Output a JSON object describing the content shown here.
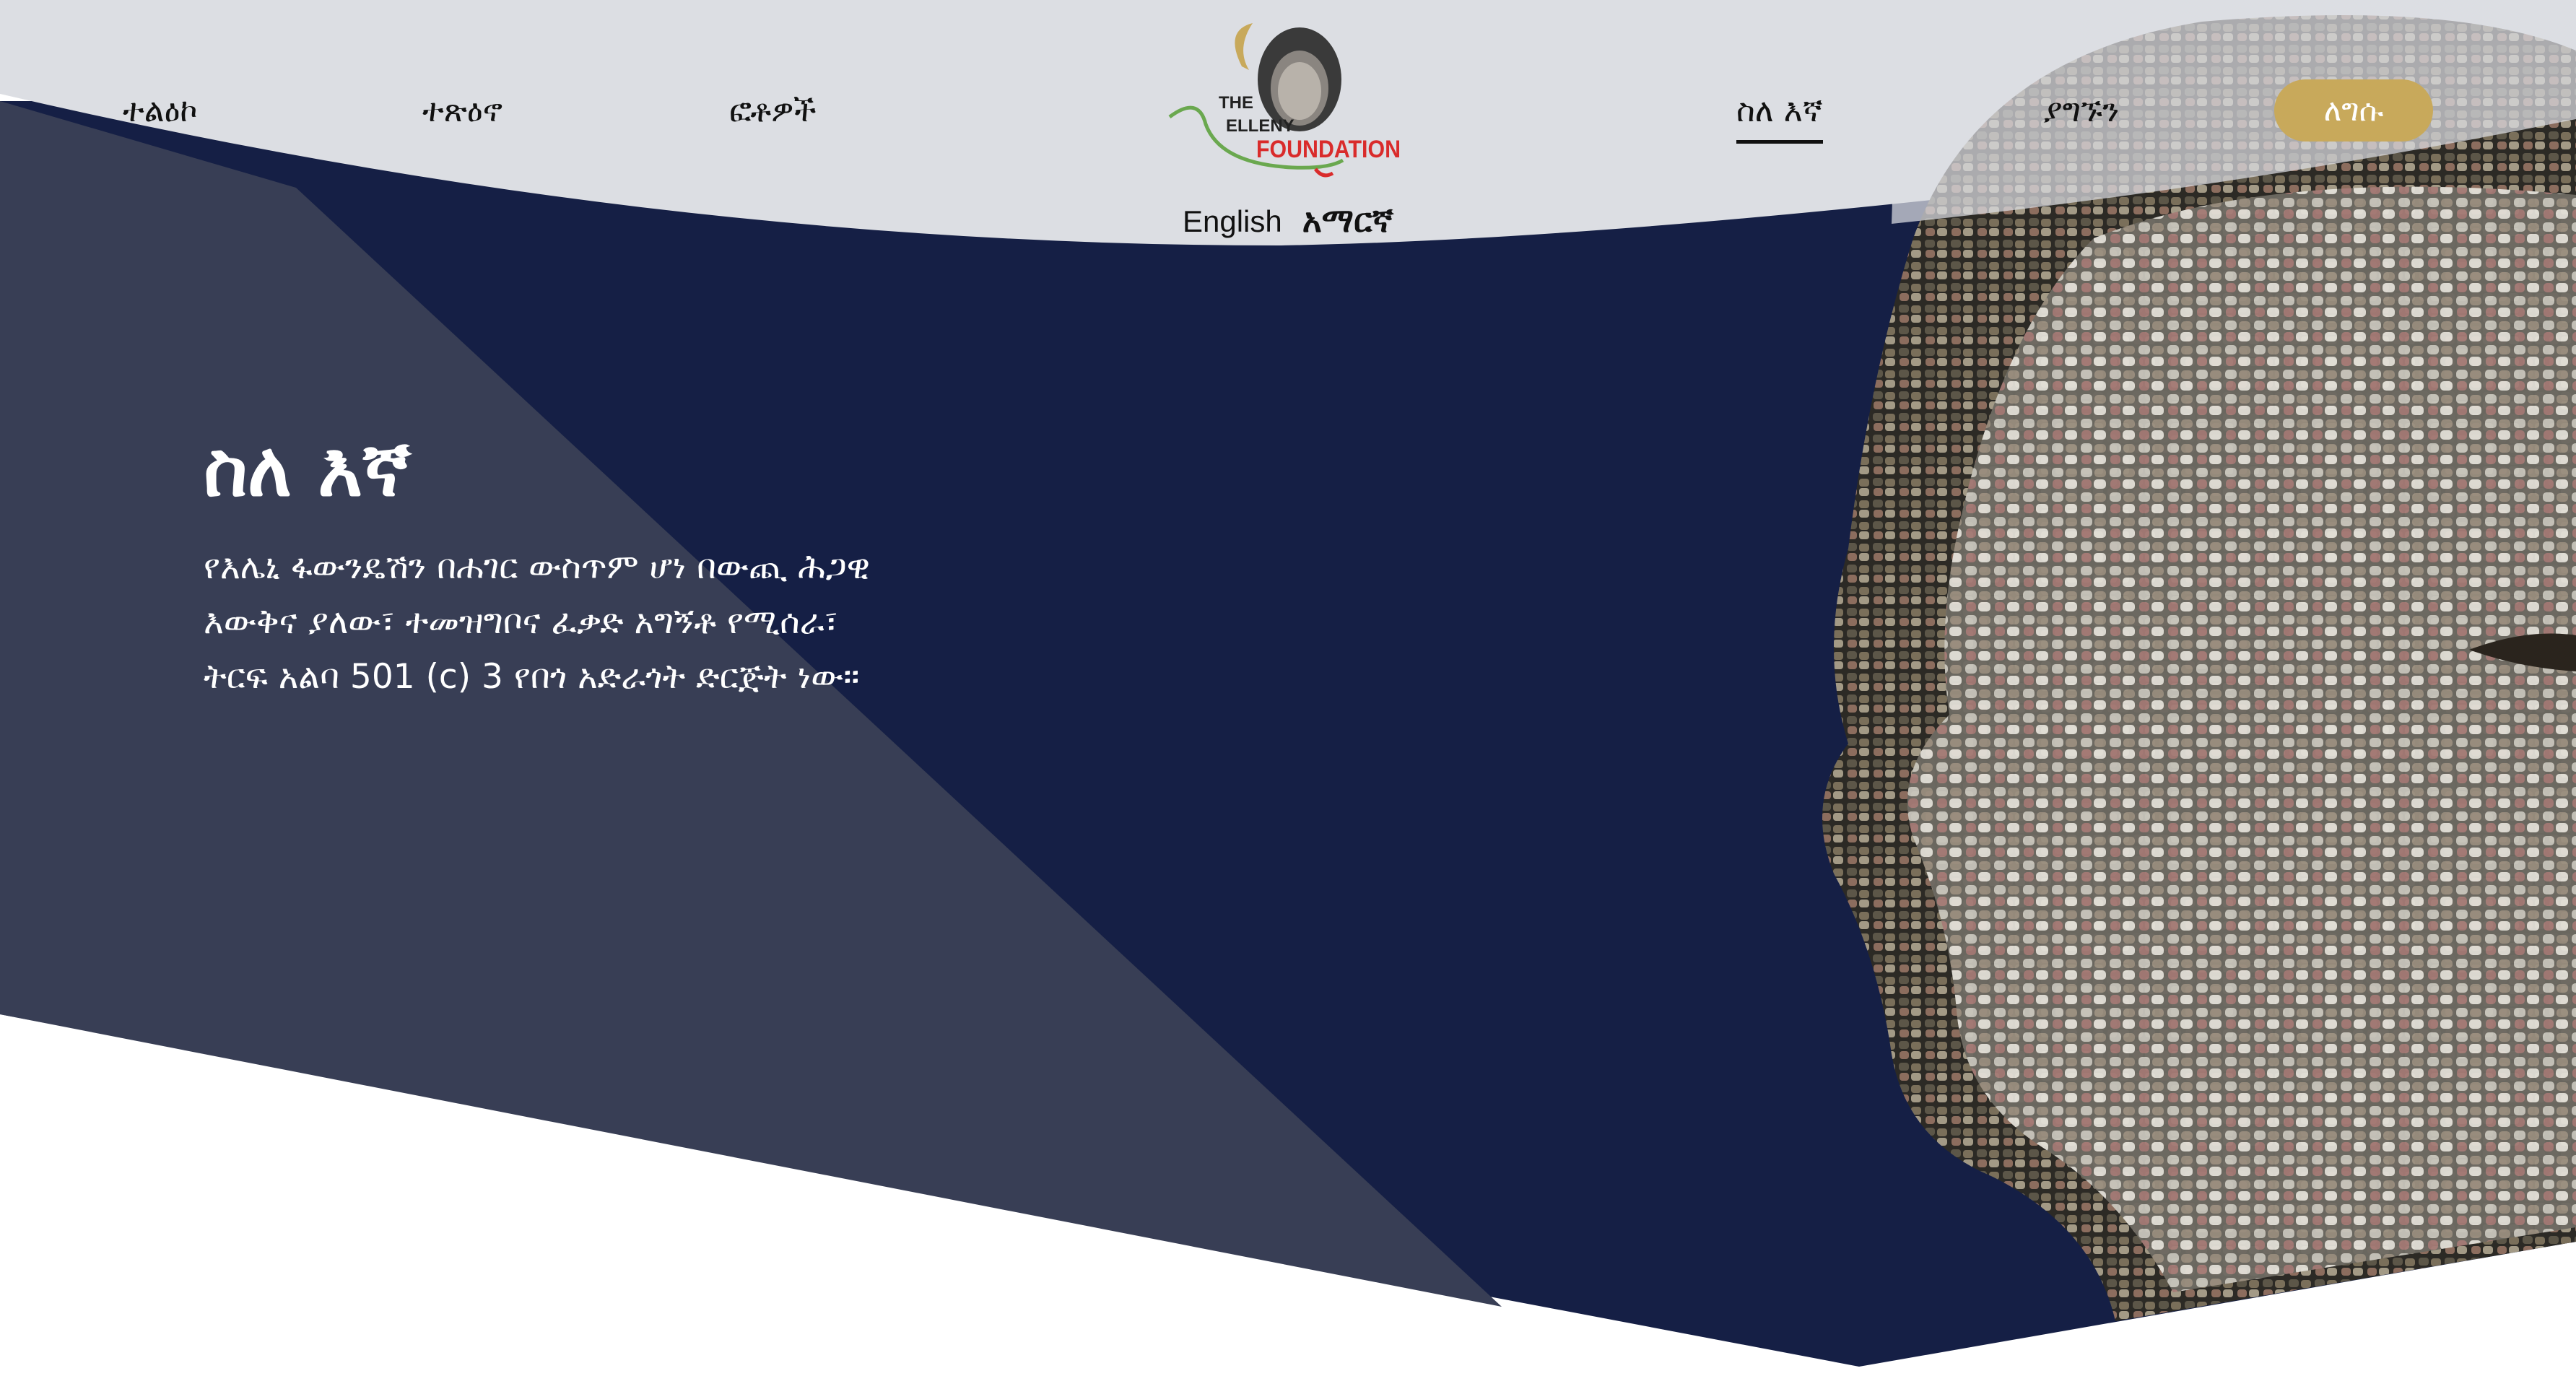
{
  "nav": {
    "left_items": [
      "ተልዕኮ",
      "ተጽዕኖ",
      "ፎቶዎች"
    ],
    "right_items": [
      "ስለ እኛ",
      "ያግኙን"
    ],
    "active_item": "ስለ እኛ",
    "donate_label": "ለግሱ"
  },
  "logo": {
    "line1": "THE",
    "line2": "ELLENY",
    "line3": "FOUNDATION"
  },
  "language": {
    "english": "English",
    "amharic": "አማርኛ",
    "selected": "አማርኛ"
  },
  "hero": {
    "title": "ስለ እኛ",
    "description": "የእሌኒ ፋውንዴሽን በሐገር ውስጥም ሆነ በውጪ ሕጋዊ እውቅና ያለው፣ ተመዝግቦና ፈቃድ አግኝቶ የሚሰራ፣ ትርፍ አልባ 501 (c) 3 የበጎ አድራጎት ድርጅት ነው።"
  },
  "colors": {
    "header_bg": "#dcdee3",
    "hero_navy": "#151f45",
    "hero_slate": "#383e55",
    "accent_gold": "#c8a95b",
    "logo_red": "#d92b2b",
    "logo_green": "#6aa84f"
  }
}
